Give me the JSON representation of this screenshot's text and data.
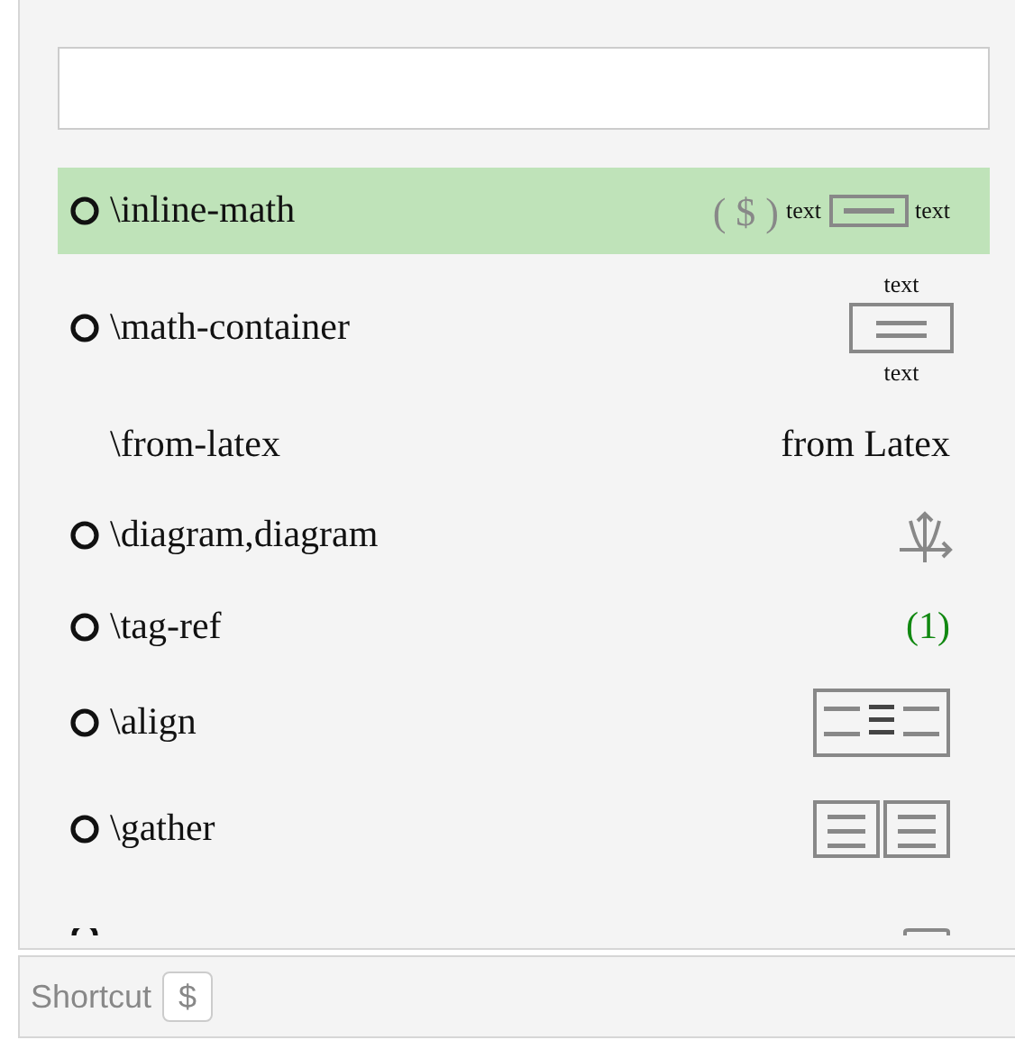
{
  "search": {
    "kind": "empty"
  },
  "items": [
    {
      "label": "\\inline-math",
      "bullet": true,
      "selected": true,
      "preview": {
        "kind": "inline",
        "symbol": "( $ )",
        "left": "text",
        "right": "text"
      }
    },
    {
      "label": "\\math-container",
      "bullet": true,
      "selected": false,
      "preview": {
        "kind": "container",
        "above": "text",
        "below": "text"
      }
    },
    {
      "label": "\\from-latex",
      "bullet": false,
      "selected": false,
      "preview": {
        "kind": "text",
        "text": "from Latex"
      }
    },
    {
      "label": "\\diagram,diagram",
      "bullet": true,
      "selected": false,
      "preview": {
        "kind": "diagram"
      }
    },
    {
      "label": "\\tag-ref",
      "bullet": true,
      "selected": false,
      "preview": {
        "kind": "tag",
        "text": "(1)"
      }
    },
    {
      "label": "\\align",
      "bullet": true,
      "selected": false,
      "preview": {
        "kind": "align"
      }
    },
    {
      "label": "\\gather",
      "bullet": true,
      "selected": false,
      "preview": {
        "kind": "gather"
      }
    },
    {
      "bullet": true,
      "preview": {
        "kind": "partial"
      }
    }
  ],
  "footer": {
    "label": "Shortcut",
    "key": "$"
  }
}
